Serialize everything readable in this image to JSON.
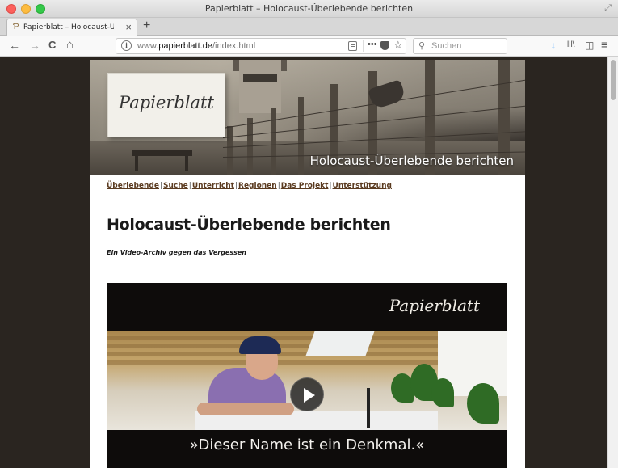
{
  "window": {
    "title": "Papierblatt – Holocaust-Überlebende berichten"
  },
  "tab": {
    "label": "Papierblatt – Holocaust-Überle",
    "close": "×",
    "new_tab": "+"
  },
  "nav": {
    "back": "←",
    "forward": "→",
    "reload": "C",
    "home": "⌂",
    "url_prefix": "www.",
    "url_domain": "papierblatt.de",
    "url_path": "/index.html",
    "more": "•••",
    "search_placeholder": "Suchen",
    "search_icon": "⚲"
  },
  "toolbar_icons": {
    "download": "↓",
    "library": "lll\\",
    "sidebar": "◫",
    "menu": "≡"
  },
  "banner": {
    "logo": "Papierblatt",
    "caption": "Holocaust-Überlebende berichten"
  },
  "menu": {
    "items": [
      "Überlebende",
      "Suche",
      "Unterricht",
      "Regionen",
      "Das Projekt",
      "Unterstützung"
    ],
    "separator": "|"
  },
  "page": {
    "title": "Holocaust-Überlebende berichten",
    "subtitle": "Ein Video-Archiv gegen das Vergessen"
  },
  "video": {
    "logo": "Papierblatt",
    "caption": "»Dieser Name ist ein Denkmal.«"
  }
}
